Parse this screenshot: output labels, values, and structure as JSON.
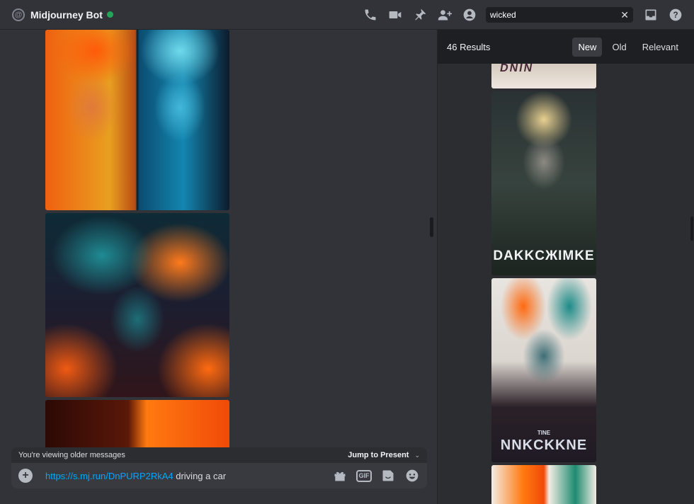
{
  "header": {
    "channel_name": "Midjourney Bot",
    "search_value": "wicked"
  },
  "chat": {
    "older_messages_text": "You're viewing older messages",
    "jump_label": "Jump to Present",
    "composer": {
      "link": "https://s.mj.run/DnPURP2RkA4",
      "text": " driving a car",
      "gif_label": "GIF"
    }
  },
  "results": {
    "count_label": "46 Results",
    "tabs": [
      "New",
      "Old",
      "Relevant"
    ],
    "active_tab": "New",
    "items": [
      {
        "poster_text": "DNIN"
      },
      {
        "poster_text": "DAKKCЖIMKE"
      },
      {
        "poster_sub": "TINE",
        "poster_text": "NNKCKKNE"
      },
      {}
    ]
  },
  "colors": {
    "accent_link": "#00a8fc",
    "online": "#23a55a"
  },
  "icons": [
    "at-icon",
    "phone-call-icon",
    "video-icon",
    "pin-icon",
    "add-user-icon",
    "profile-icon",
    "inbox-icon",
    "help-icon",
    "plus-icon",
    "gift-icon",
    "gif-icon",
    "sticker-icon",
    "emoji-icon"
  ]
}
